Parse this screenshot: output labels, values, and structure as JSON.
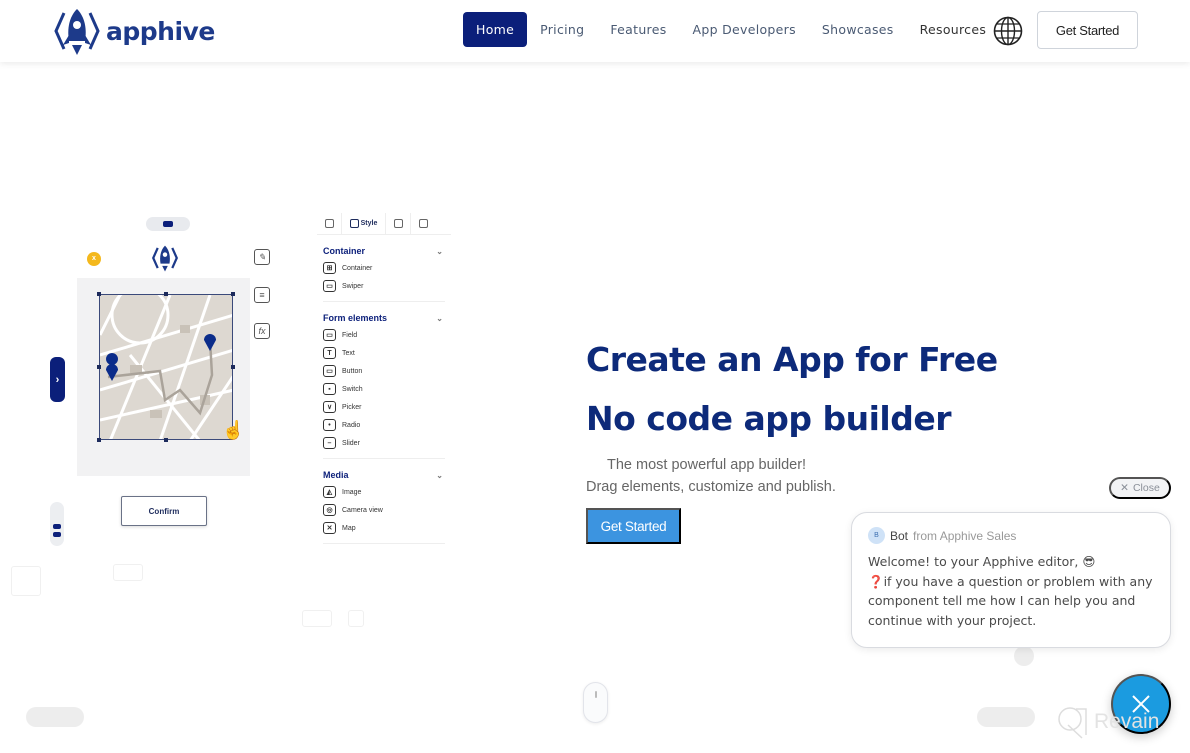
{
  "header": {
    "logo_text": "apphive",
    "nav": [
      {
        "label": "Home",
        "active": true
      },
      {
        "label": "Pricing",
        "active": false
      },
      {
        "label": "Features",
        "active": false
      },
      {
        "label": "App Developers",
        "active": false
      },
      {
        "label": "Showcases",
        "active": false
      },
      {
        "label": "Resources",
        "active": false
      }
    ],
    "language_icon": "globe-icon",
    "cta_label": "Get Started"
  },
  "editor": {
    "badge_label": "x",
    "confirm_label": "Confirm",
    "side_tab_glyph": "›",
    "tools": [
      "edit-icon",
      "text-format-icon",
      "function-icon"
    ],
    "tool_glyphs": [
      "✎",
      "≡",
      "fx"
    ],
    "panel": {
      "tabs": [
        {
          "label": "",
          "icon": "settings-icon"
        },
        {
          "label": "Style",
          "icon": "edit-icon"
        },
        {
          "label": "",
          "icon": "list-icon"
        },
        {
          "label": "",
          "icon": "resize-icon"
        }
      ],
      "sections": [
        {
          "title": "Container",
          "items": [
            {
              "label": "Container",
              "glyph": "⊞"
            },
            {
              "label": "Swiper",
              "glyph": "▭"
            }
          ]
        },
        {
          "title": "Form elements",
          "items": [
            {
              "label": "Field",
              "glyph": "▭"
            },
            {
              "label": "Text",
              "glyph": "T"
            },
            {
              "label": "Button",
              "glyph": "▭"
            },
            {
              "label": "Switch",
              "glyph": "▪"
            },
            {
              "label": "Picker",
              "glyph": "∨"
            },
            {
              "label": "Radio",
              "glyph": "•"
            },
            {
              "label": "Slider",
              "glyph": "–"
            }
          ]
        },
        {
          "title": "Media",
          "items": [
            {
              "label": "Image",
              "glyph": "◭"
            },
            {
              "label": "Camera view",
              "glyph": "◎"
            },
            {
              "label": "Map",
              "glyph": "✕"
            }
          ]
        }
      ]
    }
  },
  "hero": {
    "title": "Create an App for Free",
    "subtitle": "No code app builder",
    "desc_line1": "The most powerful app builder!",
    "desc_line2": "Drag elements, customize and publish.",
    "cta_label": "Get Started"
  },
  "chat": {
    "close_label": "Close",
    "avatar_letter": "B",
    "sender": "Bot",
    "sender_suffix": "from Apphive Sales",
    "message_line1": "Welcome! to your Apphive editor, 😎",
    "message_line2": "❓if you have a question or problem with any component tell me how I can help you and continue with your project."
  },
  "watermark": {
    "text": "Revain"
  },
  "colors": {
    "brand_navy": "#0b1f7a",
    "hero_title": "#0d2a7a",
    "cta_blue": "#3c94e0",
    "chat_fab": "#1b9be0"
  }
}
